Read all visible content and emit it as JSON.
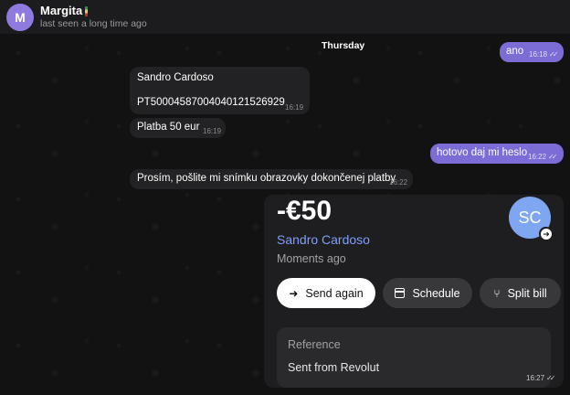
{
  "header": {
    "avatar_initial": "M",
    "name": "Margita",
    "last_seen": "last seen a long time ago"
  },
  "day_label": "Thursday",
  "messages": [
    {
      "dir": "out",
      "text": "ano",
      "time": "16:18"
    },
    {
      "dir": "in",
      "text": "Sandro Cardoso",
      "time": ""
    },
    {
      "dir": "in",
      "text": "PT50004587004040121526929",
      "time": "16:19"
    },
    {
      "dir": "in",
      "text": "Platba 50 eur",
      "time": "16:19"
    },
    {
      "dir": "out",
      "text": "hotovo daj mi heslo",
      "time": "16:22"
    },
    {
      "dir": "in",
      "text": "Prosím, pošlite mi snímku obrazovky dokončenej platby",
      "time": "16:22"
    }
  ],
  "payment_card": {
    "amount": "-€50",
    "recipient": "Sandro Cardoso",
    "when": "Moments ago",
    "avatar_initials": "SC",
    "buttons": {
      "send_again": "Send again",
      "schedule": "Schedule",
      "split_bill": "Split bill"
    },
    "reference_label": "Reference",
    "reference_value": "Sent from Revolut",
    "time": "16:27"
  },
  "colors": {
    "accent": "#7c6cd6",
    "recipient_link": "#7f9ef7"
  }
}
